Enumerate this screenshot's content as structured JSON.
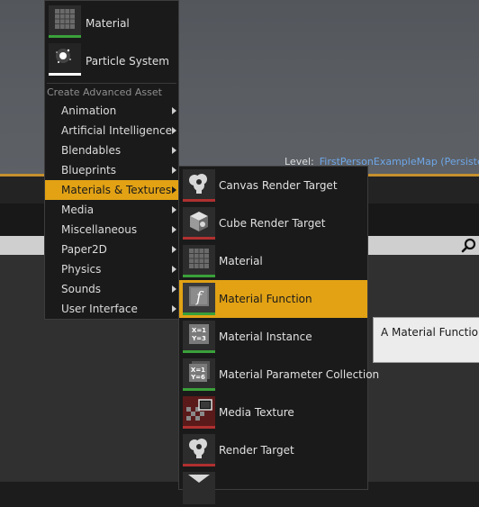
{
  "viewport": {
    "level_prefix": "Level:",
    "level_name": "FirstPersonExampleMap (Persiste"
  },
  "colors": {
    "accent": "#e2a214",
    "menu_bg": "#1a1a1a",
    "link": "#6ea6e8",
    "material_bar": "#3aa03a",
    "particle_bar": "#ffffff",
    "render_target_bar": "#b03030"
  },
  "main_menu": {
    "top_items": [
      {
        "label": "Material",
        "icon": "material-icon"
      },
      {
        "label": "Particle System",
        "icon": "particle-system-icon"
      }
    ],
    "section_header": "Create Advanced Asset",
    "categories": [
      {
        "label": "Animation"
      },
      {
        "label": "Artificial Intelligence"
      },
      {
        "label": "Blendables"
      },
      {
        "label": "Blueprints"
      },
      {
        "label": "Materials & Textures"
      },
      {
        "label": "Media"
      },
      {
        "label": "Miscellaneous"
      },
      {
        "label": "Paper2D"
      },
      {
        "label": "Physics"
      },
      {
        "label": "Sounds"
      },
      {
        "label": "User Interface"
      }
    ],
    "active_category": "Materials & Textures"
  },
  "submenu": {
    "items": [
      {
        "label": "Canvas Render Target",
        "icon": "canvas-render-target-icon"
      },
      {
        "label": "Cube Render Target",
        "icon": "cube-render-target-icon"
      },
      {
        "label": "Material",
        "icon": "material-icon"
      },
      {
        "label": "Material Function",
        "icon": "material-function-icon"
      },
      {
        "label": "Material Instance",
        "icon": "material-instance-icon"
      },
      {
        "label": "Material Parameter Collection",
        "icon": "material-parameter-collection-icon"
      },
      {
        "label": "Media Texture",
        "icon": "media-texture-icon"
      },
      {
        "label": "Render Target",
        "icon": "render-target-icon"
      }
    ],
    "active_item": "Material Function"
  },
  "tooltip": {
    "text": "A Material Function"
  },
  "search": {
    "icon": "search-icon"
  }
}
